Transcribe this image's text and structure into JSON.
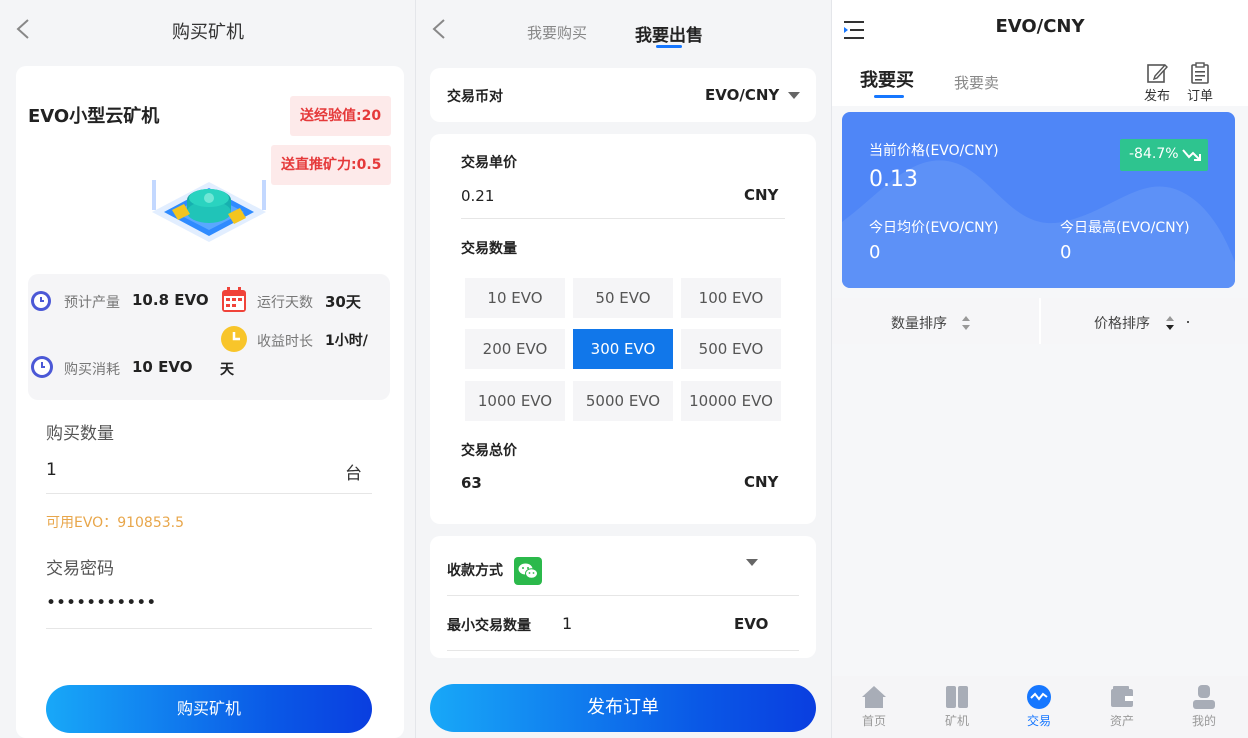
{
  "panel1": {
    "title": "购买矿机",
    "product_name": "EVO小型云矿机",
    "badge_exp": "送经验值:20",
    "badge_power": "送直推矿力:0.5",
    "stats": {
      "est_output_label": "预计产量",
      "est_output_value": "10.8 EVO",
      "run_days_label": "运行天数",
      "run_days_value": "30天",
      "income_label": "收益时长",
      "income_value_1": "1小时/",
      "income_value_2": "天",
      "cost_label": "购买消耗",
      "cost_value": "10 EVO"
    },
    "qty_label": "购买数量",
    "qty_value": "1",
    "qty_unit": "台",
    "available": "可用EVO：910853.5",
    "pwd_label": "交易密码",
    "pwd_value": "•••••••••••",
    "submit_label": "购买矿机"
  },
  "panel2": {
    "tab_buy": "我要购买",
    "tab_sell": "我要出售",
    "pair_label": "交易币对",
    "pair_value": "EVO/CNY",
    "price_label": "交易单价",
    "price_value": "0.21",
    "price_unit": "CNY",
    "qty_label": "交易数量",
    "amounts": [
      "10 EVO",
      "50 EVO",
      "100 EVO",
      "200 EVO",
      "300 EVO",
      "500 EVO",
      "1000 EVO",
      "5000 EVO",
      "10000 EVO"
    ],
    "selected_amount": "300 EVO",
    "total_label": "交易总价",
    "total_value": "63",
    "total_unit": "CNY",
    "payment_label": "收款方式",
    "min_label": "最小交易数量",
    "min_value": "1",
    "min_unit": "EVO",
    "submit_label": "发布订单"
  },
  "panel3": {
    "title": "EVO/CNY",
    "tab_buy": "我要买",
    "tab_sell": "我要卖",
    "publish_label": "发布",
    "orders_label": "订单",
    "current_price_label": "当前价格(EVO/CNY)",
    "current_price_value": "0.13",
    "change": "-84.7%",
    "avg_label": "今日均价(EVO/CNY)",
    "avg_value": "0",
    "high_label": "今日最高(EVO/CNY)",
    "high_value": "0",
    "sort_qty": "数量排序",
    "sort_price": "价格排序",
    "nav": [
      "首页",
      "矿机",
      "交易",
      "资产",
      "我的"
    ],
    "accent_color": "#4f86f7",
    "change_color": "#2ec48f"
  }
}
